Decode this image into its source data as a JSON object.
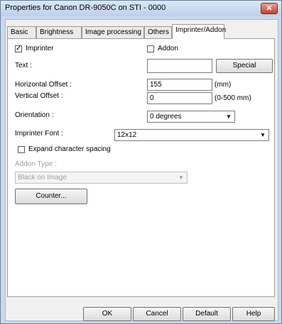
{
  "window": {
    "title": "Properties for Canon DR-9050C on STI - 0000",
    "close_symbol": "✕"
  },
  "tabs": [
    "Basic",
    "Brightness",
    "Image processing",
    "Others",
    "Imprinter/Addon"
  ],
  "imprinter": {
    "checkbox_label": "Imprinter",
    "checked": true,
    "addon_label": "Addon",
    "addon_checked": false,
    "text_label": "Text :",
    "text_value": "",
    "special_button": "Special",
    "h_offset_label": "Horizontal Offset :",
    "h_offset_value": "155",
    "h_offset_unit": "(mm)",
    "v_offset_label": "Vertical Offset :",
    "v_offset_value": "0",
    "v_offset_unit": "(0-500 mm)",
    "orientation_label": "Orientation :",
    "orientation_value": "0 degrees",
    "font_label": "Imprinter Font :",
    "font_value": "12x12",
    "expand_label": "Expand character spacing",
    "expand_checked": false,
    "addon_type_label": "Addon Type :",
    "addon_type_value": "Black on Image",
    "counter_button": "Counter..."
  },
  "footer": {
    "ok": "OK",
    "cancel": "Cancel",
    "default": "Default",
    "help": "Help"
  },
  "icons": {
    "checkmark": "✓",
    "dropdown": "▼"
  }
}
